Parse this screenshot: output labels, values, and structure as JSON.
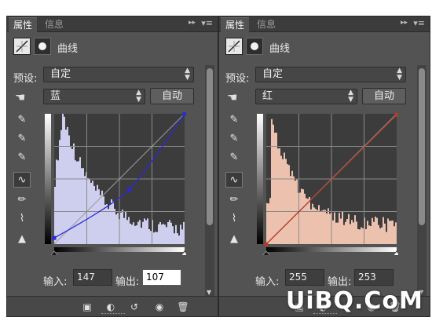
{
  "panels": [
    {
      "tabs": [
        "属性",
        "信息"
      ],
      "title": "曲线",
      "preset_label": "预设:",
      "preset_value": "自定",
      "channel_value": "蓝",
      "auto_label": "自动",
      "input_label": "输入:",
      "input_value": "147",
      "output_label": "输出:",
      "output_value": "107",
      "curve_color": "#2a2ad8",
      "histogram_color": "#d6d6f8",
      "curve_points": [
        [
          0,
          12
        ],
        [
          147,
          107
        ],
        [
          255,
          255
        ]
      ]
    },
    {
      "tabs": [
        "属性",
        "信息"
      ],
      "title": "曲线",
      "preset_label": "预设:",
      "preset_value": "自定",
      "channel_value": "红",
      "auto_label": "自动",
      "input_label": "输入:",
      "input_value": "255",
      "output_label": "输出:",
      "output_value": "253",
      "curve_color": "#b83a2a",
      "histogram_color": "#f6c8b4",
      "curve_points": [
        [
          0,
          0
        ],
        [
          255,
          253
        ]
      ]
    }
  ],
  "icons": {
    "collapse": "double-arrow-right-icon",
    "menu": "panel-menu-icon",
    "tools": [
      "eyedropper-black-icon",
      "eyedropper-gray-icon",
      "eyedropper-white-icon",
      "curve-edit-icon",
      "pencil-icon",
      "smooth-icon",
      "clipping-warning-icon"
    ],
    "bottom": [
      "clip-to-layer-icon",
      "view-previous-icon",
      "reset-icon",
      "visibility-icon",
      "trash-icon"
    ]
  },
  "glyphs": {
    "collapse": "▸▸",
    "menu": "▾≡",
    "tools": [
      "✎",
      "✎",
      "✎",
      "∿",
      "✏",
      "⌇",
      "▲"
    ],
    "bottom": [
      "▣",
      "◐",
      "↺",
      "◉",
      "🗑"
    ],
    "hand": "☚",
    "arrows_up": "▲",
    "arrows_down": "▼"
  },
  "watermark": "UiBQ.CoM"
}
